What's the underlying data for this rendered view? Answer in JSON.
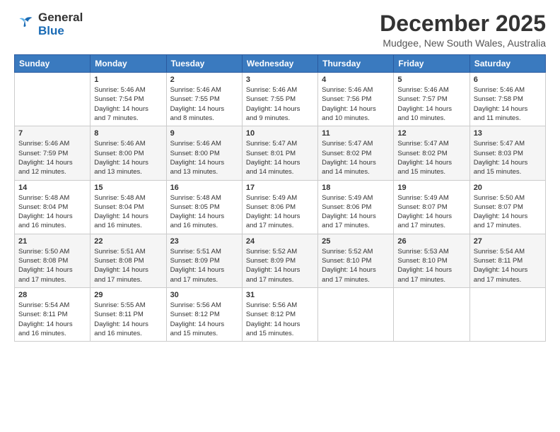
{
  "header": {
    "logo_general": "General",
    "logo_blue": "Blue",
    "month_title": "December 2025",
    "location": "Mudgee, New South Wales, Australia"
  },
  "calendar": {
    "days_of_week": [
      "Sunday",
      "Monday",
      "Tuesday",
      "Wednesday",
      "Thursday",
      "Friday",
      "Saturday"
    ],
    "weeks": [
      [
        {
          "day": "",
          "info": ""
        },
        {
          "day": "1",
          "info": "Sunrise: 5:46 AM\nSunset: 7:54 PM\nDaylight: 14 hours\nand 7 minutes."
        },
        {
          "day": "2",
          "info": "Sunrise: 5:46 AM\nSunset: 7:55 PM\nDaylight: 14 hours\nand 8 minutes."
        },
        {
          "day": "3",
          "info": "Sunrise: 5:46 AM\nSunset: 7:55 PM\nDaylight: 14 hours\nand 9 minutes."
        },
        {
          "day": "4",
          "info": "Sunrise: 5:46 AM\nSunset: 7:56 PM\nDaylight: 14 hours\nand 10 minutes."
        },
        {
          "day": "5",
          "info": "Sunrise: 5:46 AM\nSunset: 7:57 PM\nDaylight: 14 hours\nand 10 minutes."
        },
        {
          "day": "6",
          "info": "Sunrise: 5:46 AM\nSunset: 7:58 PM\nDaylight: 14 hours\nand 11 minutes."
        }
      ],
      [
        {
          "day": "7",
          "info": "Sunrise: 5:46 AM\nSunset: 7:59 PM\nDaylight: 14 hours\nand 12 minutes."
        },
        {
          "day": "8",
          "info": "Sunrise: 5:46 AM\nSunset: 8:00 PM\nDaylight: 14 hours\nand 13 minutes."
        },
        {
          "day": "9",
          "info": "Sunrise: 5:46 AM\nSunset: 8:00 PM\nDaylight: 14 hours\nand 13 minutes."
        },
        {
          "day": "10",
          "info": "Sunrise: 5:47 AM\nSunset: 8:01 PM\nDaylight: 14 hours\nand 14 minutes."
        },
        {
          "day": "11",
          "info": "Sunrise: 5:47 AM\nSunset: 8:02 PM\nDaylight: 14 hours\nand 14 minutes."
        },
        {
          "day": "12",
          "info": "Sunrise: 5:47 AM\nSunset: 8:02 PM\nDaylight: 14 hours\nand 15 minutes."
        },
        {
          "day": "13",
          "info": "Sunrise: 5:47 AM\nSunset: 8:03 PM\nDaylight: 14 hours\nand 15 minutes."
        }
      ],
      [
        {
          "day": "14",
          "info": "Sunrise: 5:48 AM\nSunset: 8:04 PM\nDaylight: 14 hours\nand 16 minutes."
        },
        {
          "day": "15",
          "info": "Sunrise: 5:48 AM\nSunset: 8:04 PM\nDaylight: 14 hours\nand 16 minutes."
        },
        {
          "day": "16",
          "info": "Sunrise: 5:48 AM\nSunset: 8:05 PM\nDaylight: 14 hours\nand 16 minutes."
        },
        {
          "day": "17",
          "info": "Sunrise: 5:49 AM\nSunset: 8:06 PM\nDaylight: 14 hours\nand 17 minutes."
        },
        {
          "day": "18",
          "info": "Sunrise: 5:49 AM\nSunset: 8:06 PM\nDaylight: 14 hours\nand 17 minutes."
        },
        {
          "day": "19",
          "info": "Sunrise: 5:49 AM\nSunset: 8:07 PM\nDaylight: 14 hours\nand 17 minutes."
        },
        {
          "day": "20",
          "info": "Sunrise: 5:50 AM\nSunset: 8:07 PM\nDaylight: 14 hours\nand 17 minutes."
        }
      ],
      [
        {
          "day": "21",
          "info": "Sunrise: 5:50 AM\nSunset: 8:08 PM\nDaylight: 14 hours\nand 17 minutes."
        },
        {
          "day": "22",
          "info": "Sunrise: 5:51 AM\nSunset: 8:08 PM\nDaylight: 14 hours\nand 17 minutes."
        },
        {
          "day": "23",
          "info": "Sunrise: 5:51 AM\nSunset: 8:09 PM\nDaylight: 14 hours\nand 17 minutes."
        },
        {
          "day": "24",
          "info": "Sunrise: 5:52 AM\nSunset: 8:09 PM\nDaylight: 14 hours\nand 17 minutes."
        },
        {
          "day": "25",
          "info": "Sunrise: 5:52 AM\nSunset: 8:10 PM\nDaylight: 14 hours\nand 17 minutes."
        },
        {
          "day": "26",
          "info": "Sunrise: 5:53 AM\nSunset: 8:10 PM\nDaylight: 14 hours\nand 17 minutes."
        },
        {
          "day": "27",
          "info": "Sunrise: 5:54 AM\nSunset: 8:11 PM\nDaylight: 14 hours\nand 17 minutes."
        }
      ],
      [
        {
          "day": "28",
          "info": "Sunrise: 5:54 AM\nSunset: 8:11 PM\nDaylight: 14 hours\nand 16 minutes."
        },
        {
          "day": "29",
          "info": "Sunrise: 5:55 AM\nSunset: 8:11 PM\nDaylight: 14 hours\nand 16 minutes."
        },
        {
          "day": "30",
          "info": "Sunrise: 5:56 AM\nSunset: 8:12 PM\nDaylight: 14 hours\nand 15 minutes."
        },
        {
          "day": "31",
          "info": "Sunrise: 5:56 AM\nSunset: 8:12 PM\nDaylight: 14 hours\nand 15 minutes."
        },
        {
          "day": "",
          "info": ""
        },
        {
          "day": "",
          "info": ""
        },
        {
          "day": "",
          "info": ""
        }
      ]
    ]
  }
}
